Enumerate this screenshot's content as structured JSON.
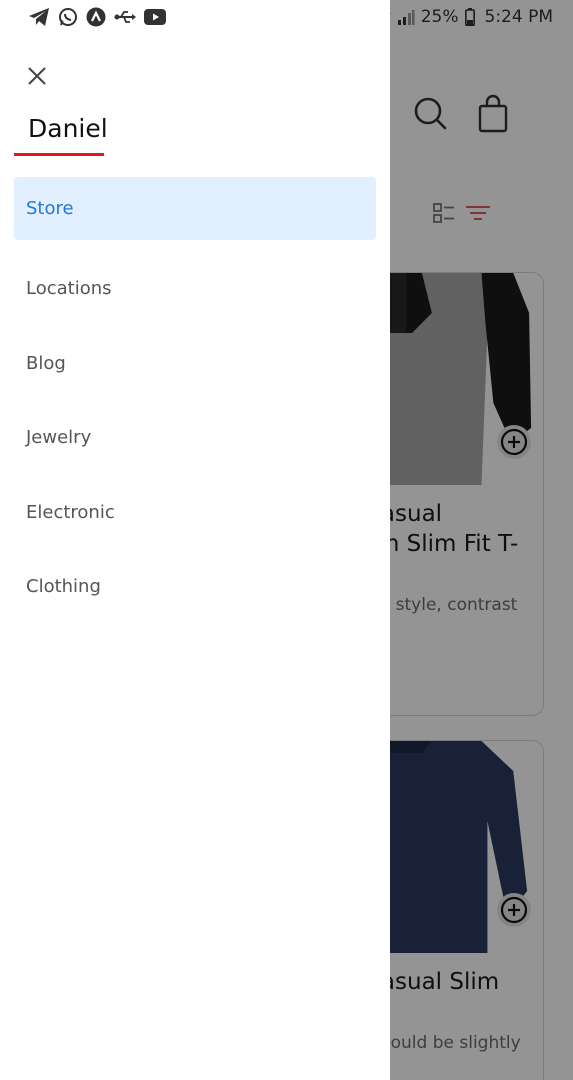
{
  "status_bar": {
    "icons": [
      "telegram-icon",
      "whatsapp-icon",
      "app-icon",
      "usb-icon",
      "youtube-icon"
    ],
    "right_icons": [
      "headset-icon",
      "wifi-icon",
      "signal-icon",
      "battery-icon"
    ],
    "battery": "25%",
    "time": "5:24 PM"
  },
  "drawer": {
    "user_name": "Daniel",
    "accent_color": "#e3161c",
    "active_color": "#1e7ad8",
    "items": [
      {
        "label": "Store",
        "active": true
      },
      {
        "label": "Locations",
        "active": false
      },
      {
        "label": "Blog",
        "active": false
      },
      {
        "label": "Jewelry",
        "active": false
      },
      {
        "label": "Electronic",
        "active": false
      },
      {
        "label": "Clothing",
        "active": false
      }
    ]
  },
  "background": {
    "header_icons": [
      "search-icon",
      "shopping-bag-icon"
    ],
    "toolbar_icons": [
      "list-view-icon",
      "filter-icon"
    ],
    "products": [
      {
        "title": "Mens Casual Premium Slim Fit T-Shirts",
        "description": "Slim-fitting style, contrast r..."
      },
      {
        "title": "Mens Casual Slim Fit",
        "description": "The color could be slightly di..."
      }
    ]
  }
}
